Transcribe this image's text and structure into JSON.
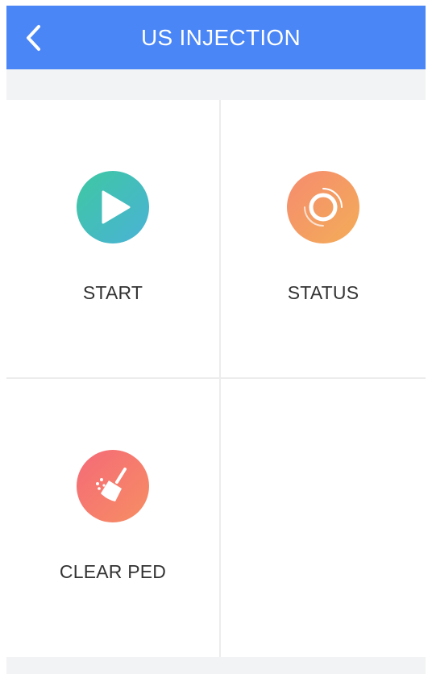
{
  "header": {
    "title": "US INJECTION",
    "back_icon": "chevron-left-icon",
    "background": "#4a86f6"
  },
  "tiles": [
    {
      "label": "START",
      "icon": "play-icon",
      "colors": [
        "#3ec8a2",
        "#4ab2d6"
      ]
    },
    {
      "label": "STATUS",
      "icon": "status-ring-icon",
      "colors": [
        "#f58b6f",
        "#f4ad58"
      ]
    },
    {
      "label": "CLEAR PED",
      "icon": "broom-icon",
      "colors": [
        "#f56a78",
        "#f68e63"
      ]
    }
  ]
}
